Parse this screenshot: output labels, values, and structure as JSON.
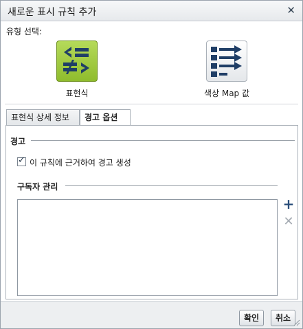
{
  "dialog": {
    "title": "새로운 표시 규칙 추가",
    "close_icon": "close-icon"
  },
  "type_select": {
    "label": "유형 선택:",
    "options": [
      {
        "label": "표현식",
        "icon": "expression-icon",
        "selected": true
      },
      {
        "label": "색상 Map 값",
        "icon": "color-map-icon",
        "selected": false
      }
    ]
  },
  "tabs": [
    {
      "label": "표현식 상세 정보",
      "active": false
    },
    {
      "label": "경고 옵션",
      "active": true
    }
  ],
  "alert": {
    "section_title": "경고",
    "checkbox_label": "이 규칙에 근거하여 경고 생성",
    "checkbox_checked": true,
    "subscribers_title": "구독자 관리",
    "subscribers": []
  },
  "footer": {
    "ok_label": "확인",
    "cancel_label": "취소"
  },
  "colors": {
    "accent_green": "#9cc63a",
    "icon_navy": "#1f3e66"
  }
}
